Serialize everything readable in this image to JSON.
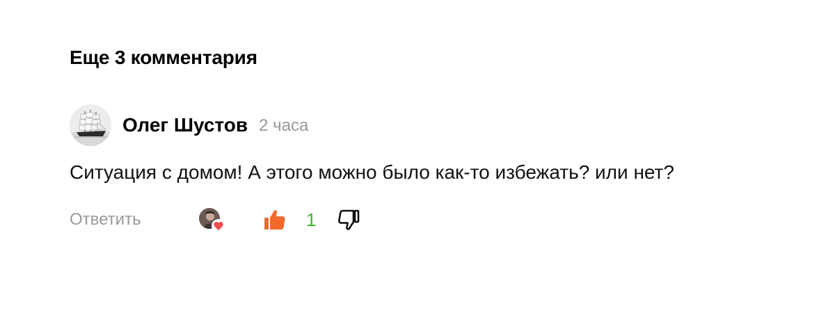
{
  "section": {
    "title": "Еще 3 комментария"
  },
  "comment": {
    "author": "Олег Шустов",
    "time": "2 часа",
    "text": "Ситуация с домом! А этого можно было как-то избежать? или нет?",
    "actions": {
      "reply_label": "Ответить",
      "like_count": "1"
    }
  },
  "colors": {
    "like_active": "#f36a2d",
    "like_count": "#3cb728",
    "muted_text": "#999999",
    "heart": "#f04e4e"
  },
  "icons": {
    "author_avatar": "sailing-ship-avatar",
    "reactor_avatar": "user-avatar-with-heart",
    "like": "thumbs-up-icon",
    "dislike": "thumbs-down-icon"
  }
}
